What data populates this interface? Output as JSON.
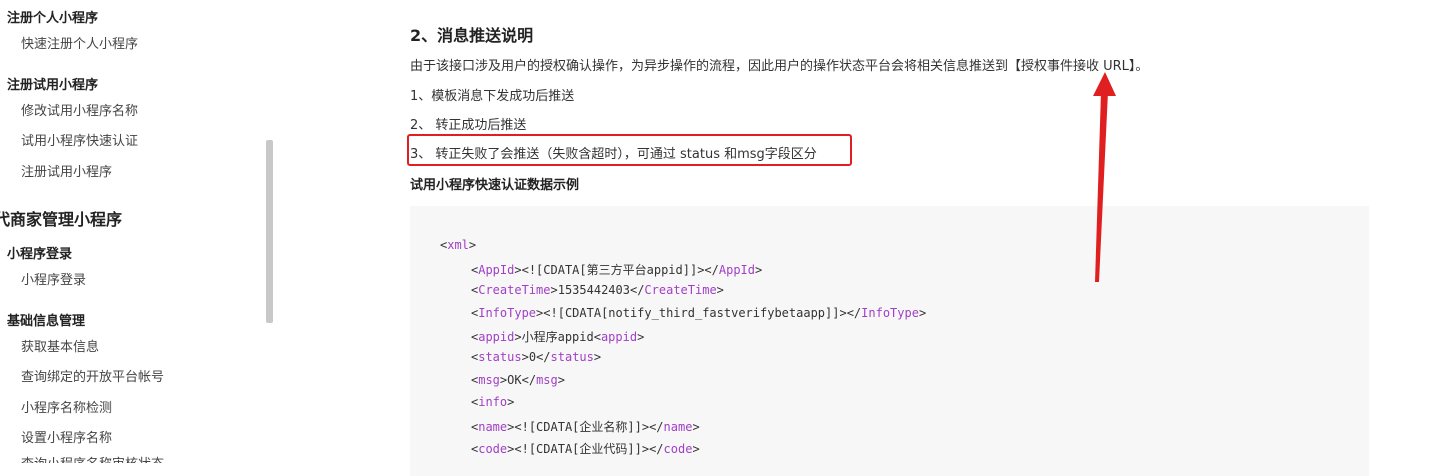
{
  "sidebar": {
    "entries": [
      {
        "type": "group",
        "label": "注册个人小程序"
      },
      {
        "type": "item",
        "label": "快速注册个人小程序"
      },
      {
        "type": "group",
        "label": "注册试用小程序"
      },
      {
        "type": "item",
        "label": "修改试用小程序名称"
      },
      {
        "type": "item",
        "label": "试用小程序快速认证"
      },
      {
        "type": "item",
        "label": "注册试用小程序"
      },
      {
        "type": "section",
        "label": "代商家管理小程序"
      },
      {
        "type": "group",
        "label": "小程序登录"
      },
      {
        "type": "item",
        "label": "小程序登录"
      },
      {
        "type": "group",
        "label": "基础信息管理"
      },
      {
        "type": "item",
        "label": "获取基本信息"
      },
      {
        "type": "item",
        "label": "查询绑定的开放平台帐号"
      },
      {
        "type": "item",
        "label": "小程序名称检测"
      },
      {
        "type": "item",
        "label": "设置小程序名称"
      },
      {
        "type": "item",
        "label": "查询小程序名称审核状态"
      }
    ]
  },
  "content": {
    "heading": "2、消息推送说明",
    "intro": "由于该接口涉及用户的授权确认操作，为异步操作的流程，因此用户的操作状态平台会将相关信息推送到【授权事件接收 URL】。",
    "points": [
      "1、模板消息下发成功后推送",
      "2、 转正成功后推送",
      "3、 转正失败了会推送（失败含超时），可通过 status 和msg字段区分"
    ],
    "example_title": "试用小程序快速认证数据示例"
  },
  "code": {
    "lines": [
      {
        "indent": 0,
        "open": "xml",
        "text": "",
        "close": ""
      },
      {
        "indent": 1,
        "open": "AppId",
        "text": "<![CDATA[第三方平台appid]]>",
        "close": "AppId"
      },
      {
        "indent": 1,
        "open": "CreateTime",
        "text": "1535442403",
        "close": "CreateTime"
      },
      {
        "indent": 1,
        "open": "InfoType",
        "text": "<![CDATA[notify_third_fastverifybetaapp]]>",
        "close": "InfoType"
      },
      {
        "indent": 1,
        "open": "appid",
        "text": "小程序appid<",
        "close": "",
        "tail_tag": "appid",
        "tail": ">"
      },
      {
        "indent": 1,
        "open": "status",
        "text": "0",
        "close": "status"
      },
      {
        "indent": 1,
        "open": "msg",
        "text": "OK",
        "close": "msg"
      },
      {
        "indent": 1,
        "open": "info",
        "text": "",
        "close": ""
      },
      {
        "indent": 1,
        "open": "name",
        "text": "<![CDATA[企业名称]]>",
        "close": "name"
      },
      {
        "indent": 1,
        "open": "code",
        "text": "<![CDATA[企业代码]]>",
        "close": "code"
      }
    ]
  },
  "colors": {
    "highlight": "#e02020",
    "arrow": "#e02020",
    "xml_tag": "#a13fc6",
    "code_bg": "#f7f7f7"
  }
}
